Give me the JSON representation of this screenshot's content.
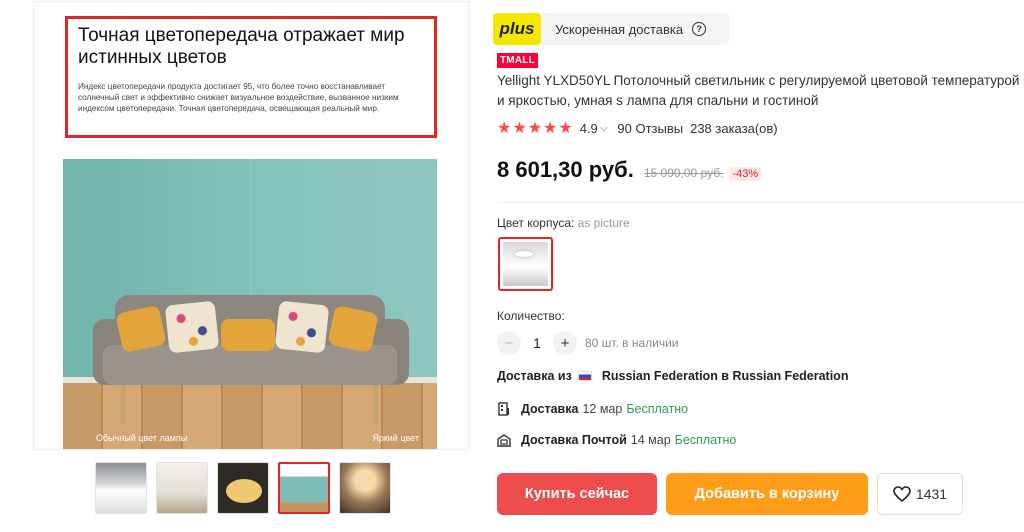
{
  "gallery": {
    "callout_title": "Точная цветопередача отражает мир истинных цветов",
    "callout_text": "Индекс цветопередачи продукта достигает 95, что более точно восстанавливает солнечный свет и эффективно снижает визуальное воздействие, вызванное низким индексом цветопередачи. Точная цветопередача, освещающая реальный мир.",
    "caption_left": "Обычный цвет лампы",
    "caption_right": "Яркий цвет"
  },
  "plus": {
    "logo": "plus",
    "text": "Ускоренная доставка",
    "help_icon": "?"
  },
  "product": {
    "store_badge": "TMALL",
    "title": "Yellight YLXD50YL Потолочный светильник с регулируемой цветовой температурой и яркостью, умная s лампа для спальни и гостиной",
    "stars": "★★★★★",
    "rating": "4.9",
    "rating_chevron": "⌵",
    "reviews": "90 Отзывы",
    "orders": "238 заказа(ов)",
    "price": "8 601,30 руб.",
    "old_price": "15 090,00 руб.",
    "discount": "-43%"
  },
  "options": {
    "color_label": "Цвет корпуса:",
    "color_value": "as picture",
    "qty_label": "Количество:",
    "qty_minus": "−",
    "qty_value": "1",
    "qty_plus": "+",
    "stock": "80 шт. в наличии"
  },
  "shipping": {
    "from_label": "Доставка из",
    "from_value": "Russian Federation в Russian Federation",
    "row1_label": "Доставка",
    "row1_date": "12 мар",
    "row1_price": "Бесплатно",
    "row2_label": "Доставка Почтой",
    "row2_date": "14 мар",
    "row2_price": "Бесплатно"
  },
  "actions": {
    "buy": "Купить сейчас",
    "cart": "Добавить в корзину",
    "favorites_count": "1431"
  },
  "colors": {
    "accent_red": "#e02525",
    "buy_button": "#ee4d4d",
    "cart_button": "#ff9c1a",
    "plus_yellow": "#f3e600",
    "free_green": "#2a9d57"
  }
}
